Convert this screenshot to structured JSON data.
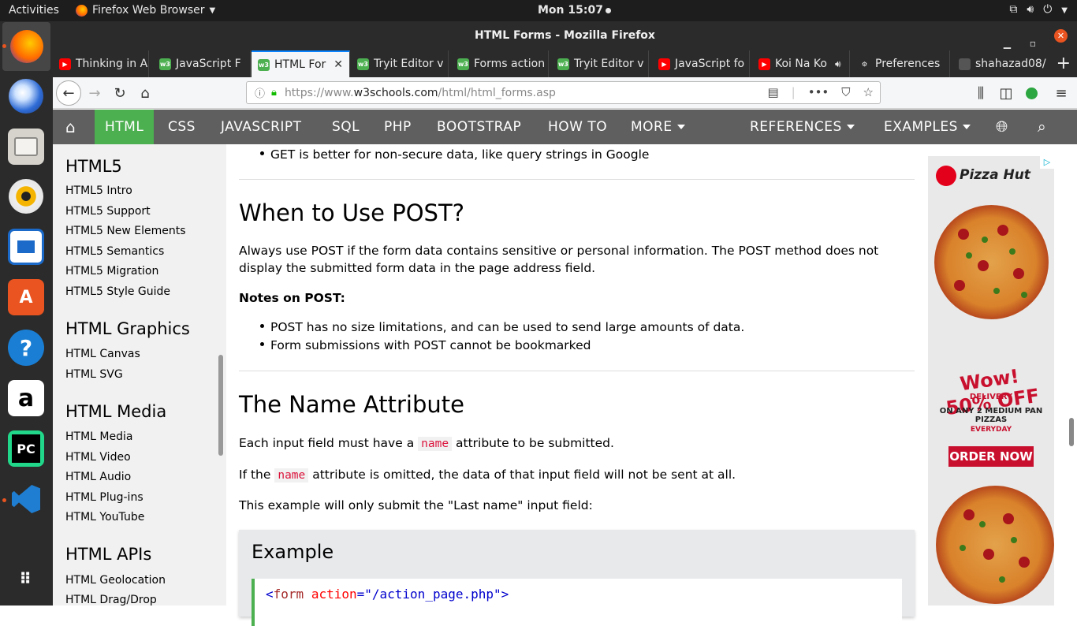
{
  "topbar": {
    "activities": "Activities",
    "app_name": "Firefox Web Browser",
    "clock": "Mon 15:07"
  },
  "window": {
    "title": "HTML Forms - Mozilla Firefox"
  },
  "tabs": [
    {
      "label": "Thinking in A",
      "favicon": "youtube-icon",
      "active": false
    },
    {
      "label": "JavaScript F",
      "favicon": "w3schools-icon",
      "active": false
    },
    {
      "label": "HTML For",
      "favicon": "w3schools-icon",
      "active": true
    },
    {
      "label": "Tryit Editor v",
      "favicon": "w3schools-icon",
      "active": false
    },
    {
      "label": "Forms action",
      "favicon": "w3schools-icon",
      "active": false
    },
    {
      "label": "Tryit Editor v",
      "favicon": "w3schools-icon",
      "active": false
    },
    {
      "label": "JavaScript fo",
      "favicon": "youtube-icon",
      "active": false
    },
    {
      "label": "Koi Na Ko",
      "favicon": "youtube-icon",
      "active": false
    },
    {
      "label": "Preferences",
      "favicon": "gear-icon",
      "active": false
    },
    {
      "label": "shahazad08/",
      "favicon": "github-icon",
      "active": false
    }
  ],
  "urlbar": {
    "url_prefix": "https://www.",
    "url_domain": "w3schools.com",
    "url_path": "/html/html_forms.asp"
  },
  "w3nav": {
    "items": [
      "HTML",
      "CSS",
      "JAVASCRIPT",
      "SQL",
      "PHP",
      "BOOTSTRAP",
      "HOW TO",
      "MORE"
    ],
    "references": "REFERENCES",
    "examples": "EXAMPLES"
  },
  "sidebar": {
    "sections": [
      {
        "title": "HTML5",
        "links": [
          "HTML5 Intro",
          "HTML5 Support",
          "HTML5 New Elements",
          "HTML5 Semantics",
          "HTML5 Migration",
          "HTML5 Style Guide"
        ]
      },
      {
        "title": "HTML Graphics",
        "links": [
          "HTML Canvas",
          "HTML SVG"
        ]
      },
      {
        "title": "HTML Media",
        "links": [
          "HTML Media",
          "HTML Video",
          "HTML Audio",
          "HTML Plug-ins",
          "HTML YouTube"
        ]
      },
      {
        "title": "HTML APIs",
        "links": [
          "HTML Geolocation",
          "HTML Drag/Drop"
        ]
      }
    ]
  },
  "content": {
    "get_bullet": "GET is better for non-secure data, like query strings in Google",
    "post_heading": "When to Use POST?",
    "post_paragraph": "Always use POST if the form data contains sensitive or personal information. The POST method does not display the submitted form data in the page address field.",
    "notes_heading": "Notes on POST:",
    "post_bullets": [
      "POST has no size limitations, and can be used to send large amounts of data.",
      "Form submissions with POST cannot be bookmarked"
    ],
    "name_heading": "The Name Attribute",
    "name_p1_before": "Each input field must have a",
    "name_code": "name",
    "name_p1_after": "attribute to be submitted.",
    "name_p2_before": "If the",
    "name_p2_after": "attribute is omitted, the data of that input field will not be sent at all.",
    "name_p3": "This example will only submit the \"Last name\" input field:",
    "example_title": "Example",
    "code_open": "<",
    "code_tag": "form",
    "code_attr": "action",
    "code_eq": "=",
    "code_val": "\"/action_page.php\"",
    "code_close": ">"
  },
  "ad": {
    "brand": "Pizza Hut",
    "promo_headline": "Wow! 50% OFF",
    "promo_sub": "DELIVERY",
    "promo_line": "ON ANY 2 MEDIUM PAN PIZZAS",
    "promo_tag": "EVERYDAY",
    "cta": "ORDER NOW"
  }
}
